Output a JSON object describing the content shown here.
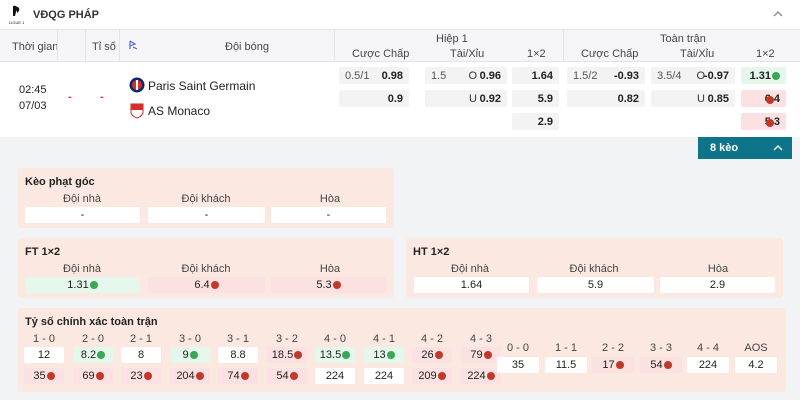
{
  "header": {
    "league": "VĐQG PHÁP",
    "logo_text": "LIGUE 1"
  },
  "table_headers": {
    "time": "Thời gian",
    "score": "Tỉ số",
    "teams": "Đội bóng",
    "half1": "Hiệp 1",
    "full": "Toàn trận",
    "handicap": "Cược Chấp",
    "ou": "Tài/Xỉu",
    "x12": "1×2"
  },
  "match": {
    "time": "02:45",
    "date": "07/03",
    "score_home": "-",
    "score_away": "-",
    "home": "Paris Saint Germain",
    "away": "AS Monaco",
    "h1_hcp_line": "0.5/1",
    "h1_hcp_home": "0.98",
    "h1_hcp_away": "0.9",
    "h1_ou_line": "1.5",
    "h1_ou_o": "O",
    "h1_ou_u": "U",
    "h1_ou_over": "0.96",
    "h1_ou_under": "0.92",
    "h1_1": "1.64",
    "h1_2": "5.9",
    "h1_x": "2.9",
    "ft_hcp_line": "1.5/2",
    "ft_hcp_home": "-0.93",
    "ft_hcp_away": "0.82",
    "ft_ou_line": "3.5/4",
    "ft_ou_o": "O",
    "ft_ou_u": "U",
    "ft_ou_over": "-0.97",
    "ft_ou_under": "0.85",
    "ft_1": "1.31",
    "ft_2": "6.4",
    "ft_x": "5.3"
  },
  "more_button": "8 kèo",
  "corner": {
    "title": "Kèo phạt góc",
    "labels": [
      "Đội nhà",
      "Đội khách",
      "Hòa"
    ],
    "values": [
      "-",
      "-",
      "-"
    ]
  },
  "ft12": {
    "title": "FT 1×2",
    "labels": [
      "Đội nhà",
      "Đội khách",
      "Hòa"
    ],
    "values": [
      "1.31",
      "6.4",
      "5.3"
    ]
  },
  "ht12": {
    "title": "HT 1×2",
    "labels": [
      "Đội nhà",
      "Đội khách",
      "Hòa"
    ],
    "values": [
      "1.64",
      "5.9",
      "2.9"
    ]
  },
  "correct_score": {
    "title": "Tỷ số chính xác toàn trận",
    "left_labels": [
      "1 - 0",
      "2 - 0",
      "2 - 1",
      "3 - 0",
      "3 - 1",
      "3 - 2",
      "4 - 0",
      "4 - 1",
      "4 - 2",
      "4 - 3"
    ],
    "left_row1": [
      "12",
      "8.2",
      "8",
      "9",
      "8.8",
      "18.5",
      "13.5",
      "13",
      "26",
      "79"
    ],
    "left_row2": [
      "35",
      "69",
      "23",
      "204",
      "74",
      "54",
      "224",
      "224",
      "209",
      "224"
    ],
    "right_labels": [
      "0 - 0",
      "1 - 1",
      "2 - 2",
      "3 - 3",
      "4 - 4",
      "AOS"
    ],
    "right_row": [
      "35",
      "11.5",
      "17",
      "54",
      "224",
      "4.2"
    ]
  }
}
